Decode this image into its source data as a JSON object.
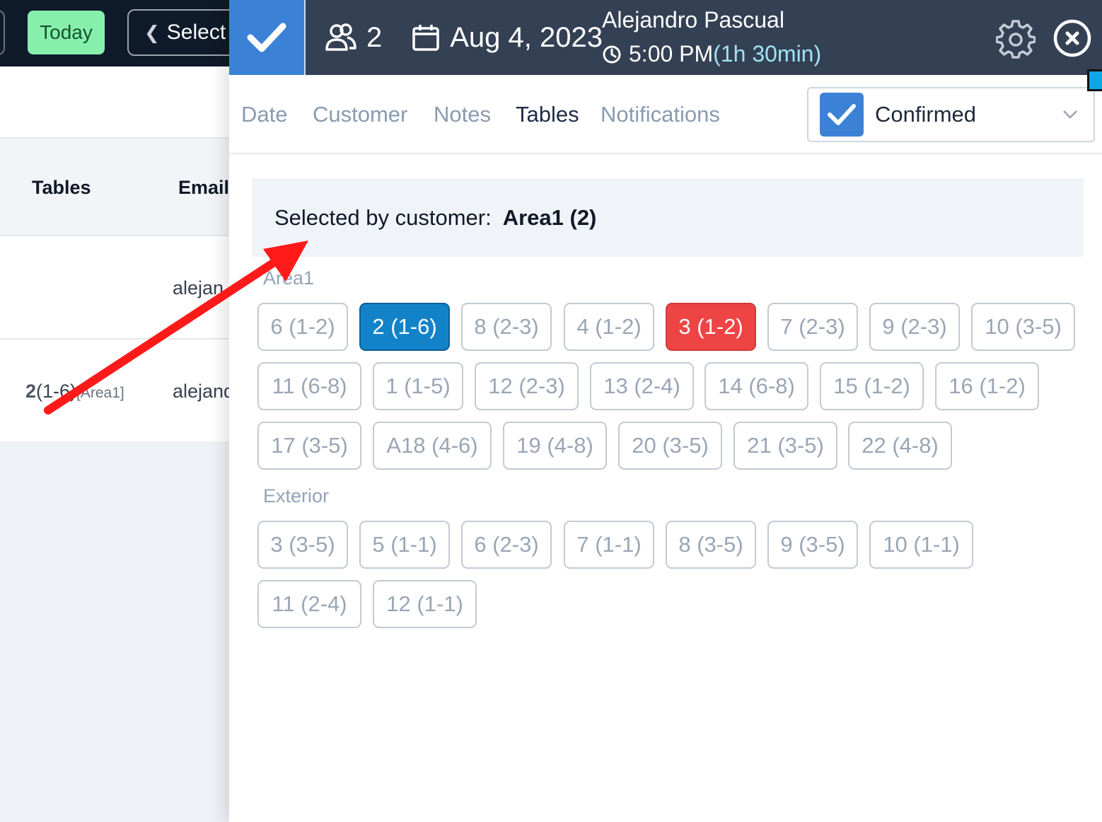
{
  "background": {
    "today_label": "Today",
    "select_label": "Select",
    "col_tables": "Tables",
    "col_email": "Email",
    "row1_email": "alejan",
    "row2_table_main": "2",
    "row2_table_range": "(1-6)",
    "row2_table_area": "[Area1]",
    "row2_email": "alejand"
  },
  "panel": {
    "guests": "2",
    "date": "Aug 4, 2023",
    "customer_name": "Alejandro Pascual",
    "time": "5:00 PM",
    "duration": "(1h 30min)",
    "tabs": [
      "Date",
      "Customer",
      "Notes",
      "Tables",
      "Notifications"
    ],
    "active_tab": "Tables",
    "status": "Confirmed",
    "selected_label": "Selected by customer:",
    "selected_value": "Area1 (2)",
    "areas": [
      {
        "name": "Area1",
        "tables": [
          "6 (1-2)",
          "2 (1-6)",
          "8 (2-3)",
          "4 (1-2)",
          "3 (1-2)",
          "7 (2-3)",
          "9 (2-3)",
          "10 (3-5)",
          "11 (6-8)",
          "1 (1-5)",
          "12 (2-3)",
          "13 (2-4)",
          "14 (6-8)",
          "15 (1-2)",
          "16 (1-2)",
          "17 (3-5)",
          "A18 (4-6)",
          "19 (4-8)",
          "20 (3-5)",
          "21 (3-5)",
          "22 (4-8)"
        ],
        "selected": "2 (1-6)",
        "taken": "3 (1-2)"
      },
      {
        "name": "Exterior",
        "tables": [
          "3 (3-5)",
          "5 (1-1)",
          "6 (2-3)",
          "7 (1-1)",
          "8 (3-5)",
          "9 (3-5)",
          "10 (1-1)",
          "11 (2-4)",
          "12 (1-1)"
        ]
      }
    ]
  },
  "colors": {
    "header_bg": "#344054",
    "accent_blue": "#3b82d6",
    "selected_table": "#1283c9",
    "taken_table": "#ef4444",
    "annotation_arrow": "#ff1a1a"
  },
  "icons": [
    "check-icon",
    "guests-icon",
    "calendar-icon",
    "clock-icon",
    "gear-icon",
    "close-icon",
    "chevron-down-icon",
    "chevron-left-icon"
  ]
}
